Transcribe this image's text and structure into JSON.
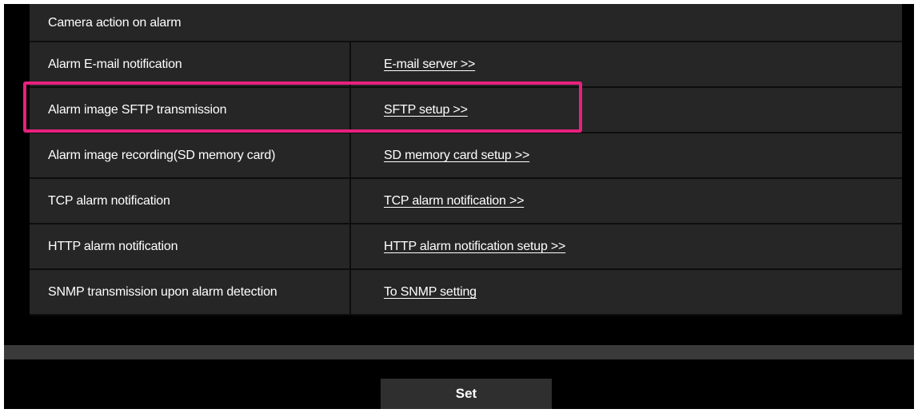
{
  "section": {
    "title": "Camera action on alarm"
  },
  "rows": [
    {
      "label": "Alarm E-mail notification",
      "link": "E-mail server >>"
    },
    {
      "label": "Alarm image SFTP transmission",
      "link": "SFTP setup >>"
    },
    {
      "label": "Alarm image recording(SD memory card)",
      "link": "SD memory card setup >>"
    },
    {
      "label": "TCP alarm notification",
      "link": "TCP alarm notification >>"
    },
    {
      "label": "HTTP alarm notification",
      "link": "HTTP alarm notification setup >>"
    },
    {
      "label": "SNMP transmission upon alarm detection",
      "link": "To SNMP setting"
    }
  ],
  "highlight": {
    "row_index": 1,
    "color": "#e8207e"
  },
  "footer": {
    "set_label": "Set"
  },
  "colors": {
    "background": "#000000",
    "row_background": "#262626",
    "separator": "#0d0d0d",
    "bar": "#3a3a3a",
    "button": "#2f2f2f",
    "text": "#ffffff"
  }
}
